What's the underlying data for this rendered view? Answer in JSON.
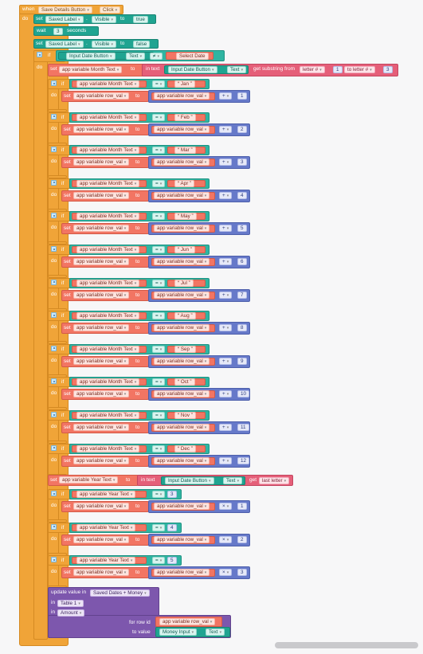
{
  "event": {
    "when": "when",
    "component": "Save Details Button",
    "event": "Click",
    "do": "do"
  },
  "kw": {
    "set": "set",
    "to": "to",
    "if": "if",
    "do": "do",
    "wait": "wait",
    "seconds": "seconds",
    "in_text": "in text",
    "get_substring_from": "get substring from",
    "to_letter": "to letter #",
    "letter": "letter #",
    "get": "get",
    "last_letter": "last letter",
    "update": "update value in",
    "in": "in",
    "for_row_id": "for row id",
    "to_value": "to value"
  },
  "first": {
    "comp": "Saved Label",
    "prop": "Visible",
    "value": "true"
  },
  "wait": {
    "n": "3"
  },
  "second": {
    "comp": "Saved Label",
    "prop": "Visible",
    "value": "false"
  },
  "cond": {
    "comp": "Input Date Button",
    "prop": "Text",
    "op": "≠",
    "str": "Select Date"
  },
  "month_set": {
    "var": "app variable Month Text",
    "comp": "Input Date Button",
    "prop": "Text",
    "from": "1",
    "to": "3"
  },
  "months": [
    {
      "name": "Jan",
      "n": "1"
    },
    {
      "name": "Feb",
      "n": "2"
    },
    {
      "name": "Mar",
      "n": "3"
    },
    {
      "name": "Apr",
      "n": "4"
    },
    {
      "name": "May",
      "n": "5"
    },
    {
      "name": "Jun",
      "n": "6"
    },
    {
      "name": "Jul",
      "n": "7"
    },
    {
      "name": "Aug",
      "n": "8"
    },
    {
      "name": "Sep",
      "n": "9"
    },
    {
      "name": "Oct",
      "n": "10"
    },
    {
      "name": "Nov",
      "n": "11"
    },
    {
      "name": "Dec",
      "n": "12"
    }
  ],
  "vars": {
    "month": "app variable Month Text",
    "row": "app variable row_val",
    "year": "app variable Year Text",
    "eq": "=",
    "plus": "+",
    "times": "×"
  },
  "year_set": {
    "var": "app variable Year Text",
    "comp": "Input Date Button",
    "prop": "Text"
  },
  "years": [
    {
      "val": "3",
      "n": "1"
    },
    {
      "val": "4",
      "n": "2"
    },
    {
      "val": "5",
      "n": "3"
    }
  ],
  "update": {
    "table": "Saved Dates + Money",
    "t1": "Table 1",
    "col": "Amount",
    "row_var": "app variable row_val",
    "money": "Money Input",
    "prop": "Text"
  }
}
